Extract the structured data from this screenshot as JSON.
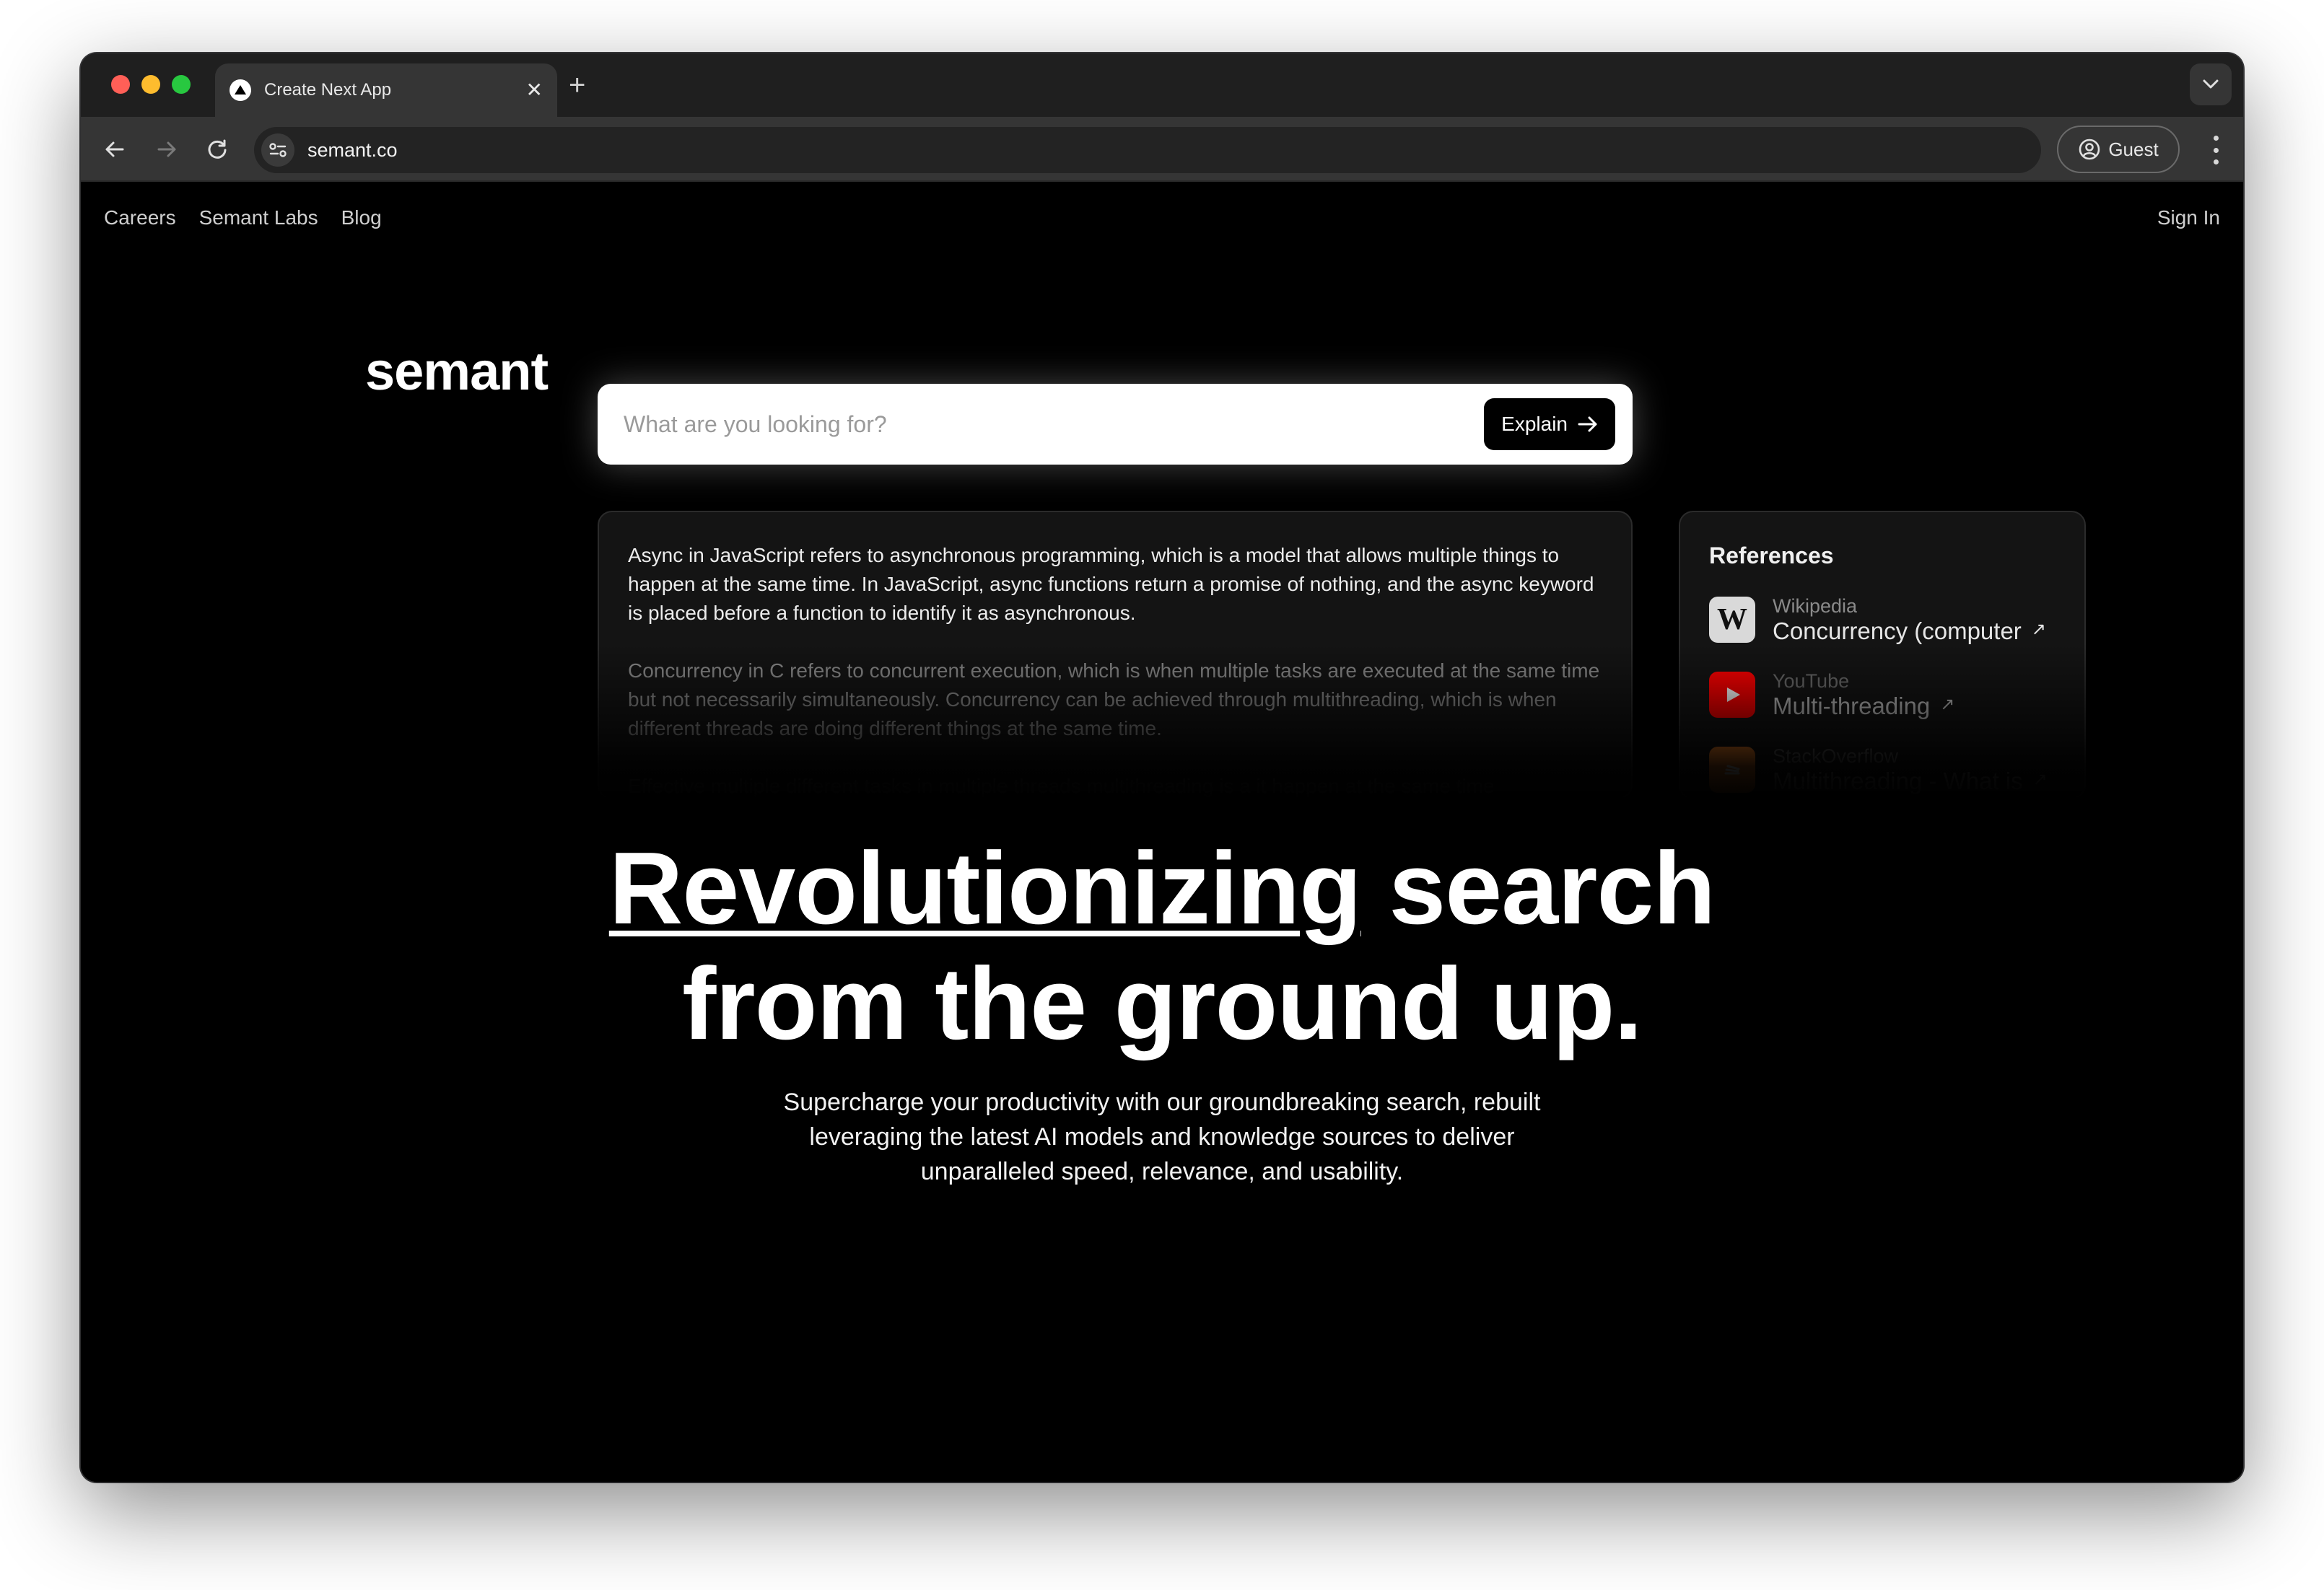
{
  "browser": {
    "tab_title": "Create Next App",
    "url": "semant.co",
    "profile_label": "Guest"
  },
  "nav": {
    "links": [
      "Careers",
      "Semant Labs",
      "Blog"
    ],
    "sign_in": "Sign In"
  },
  "brand": {
    "logo": "semant"
  },
  "search": {
    "placeholder": "What are you looking for?",
    "button_label": "Explain"
  },
  "answer": {
    "paragraphs": [
      "Async in JavaScript refers to asynchronous programming, which is a model that allows multiple things to happen at the same time. In JavaScript, async functions return a promise of nothing, and the async keyword is placed before a function to identify it as asynchronous.",
      "Concurrency in C refers to concurrent execution, which is when multiple tasks are executed at the same time but not necessarily simultaneously. Concurrency can be achieved through multithreading, which is when different threads are doing different things at the same time.",
      "Effective multiple different tasks in multiple threads multithreading is a it happen at the same time"
    ]
  },
  "references": {
    "title": "References",
    "items": [
      {
        "source": "Wikipedia",
        "title": "Concurrency (computer",
        "icon": "wikipedia-icon",
        "icon_bg": "#d9d9d9",
        "icon_fg": "#111111"
      },
      {
        "source": "YouTube",
        "title": "Multi-threading",
        "icon": "youtube-icon",
        "icon_bg": "#ff0000",
        "icon_fg": "#ffffff"
      },
      {
        "source": "StackOverflow",
        "title": "Multithreading - What is",
        "icon": "stackoverflow-icon",
        "icon_bg": "#f48024",
        "icon_fg": "#ffffff"
      }
    ]
  },
  "hero": {
    "headline_underlined": "Revolutionizing",
    "headline_rest_line1": " search",
    "headline_line2": "from the ground up.",
    "subhead_lines": [
      "Supercharge your productivity with our groundbreaking search, rebuilt",
      "leveraging the latest AI models and knowledge sources to deliver",
      "unparalleled speed, relevance, and usability."
    ]
  }
}
